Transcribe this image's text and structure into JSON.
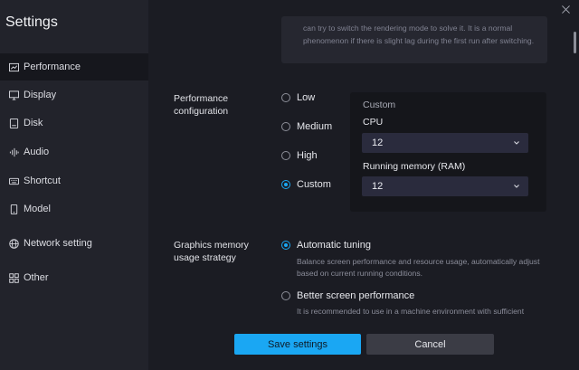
{
  "window": {
    "title": "Settings",
    "close_icon": "close-icon"
  },
  "sidebar": {
    "items": [
      {
        "label": "Performance",
        "icon": "chart-icon",
        "active": true
      },
      {
        "label": "Display",
        "icon": "monitor-icon"
      },
      {
        "label": "Disk",
        "icon": "disk-icon"
      },
      {
        "label": "Audio",
        "icon": "audio-icon"
      },
      {
        "label": "Shortcut",
        "icon": "keyboard-icon"
      },
      {
        "label": "Model",
        "icon": "phone-icon"
      },
      {
        "label": "Network setting",
        "icon": "globe-icon"
      },
      {
        "label": "Other",
        "icon": "grid-icon"
      }
    ]
  },
  "notice": {
    "line1": "can try to switch the rendering mode to solve it. It is a normal phenomenon if there is slight lag during the first run after switching."
  },
  "performance": {
    "label": "Performance configuration",
    "options": [
      "Low",
      "Medium",
      "High",
      "Custom"
    ],
    "selected": "Custom",
    "custom_panel": {
      "title": "Custom",
      "cpu_label": "CPU",
      "cpu_value": "12",
      "ram_label": "Running memory (RAM)",
      "ram_value": "12"
    }
  },
  "graphics_memory": {
    "label": "Graphics memory usage strategy",
    "options": [
      {
        "label": "Automatic tuning",
        "desc": "Balance screen performance and resource usage, automatically adjust based on current running conditions.",
        "selected": true
      },
      {
        "label": "Better screen performance",
        "desc": "It is recommended to use in a machine environment with sufficient",
        "selected": false
      }
    ]
  },
  "footer": {
    "save_label": "Save settings",
    "cancel_label": "Cancel"
  },
  "colors": {
    "accent": "#1aa7f3",
    "background": "#1b1c23",
    "sidebar": "#22232b"
  }
}
